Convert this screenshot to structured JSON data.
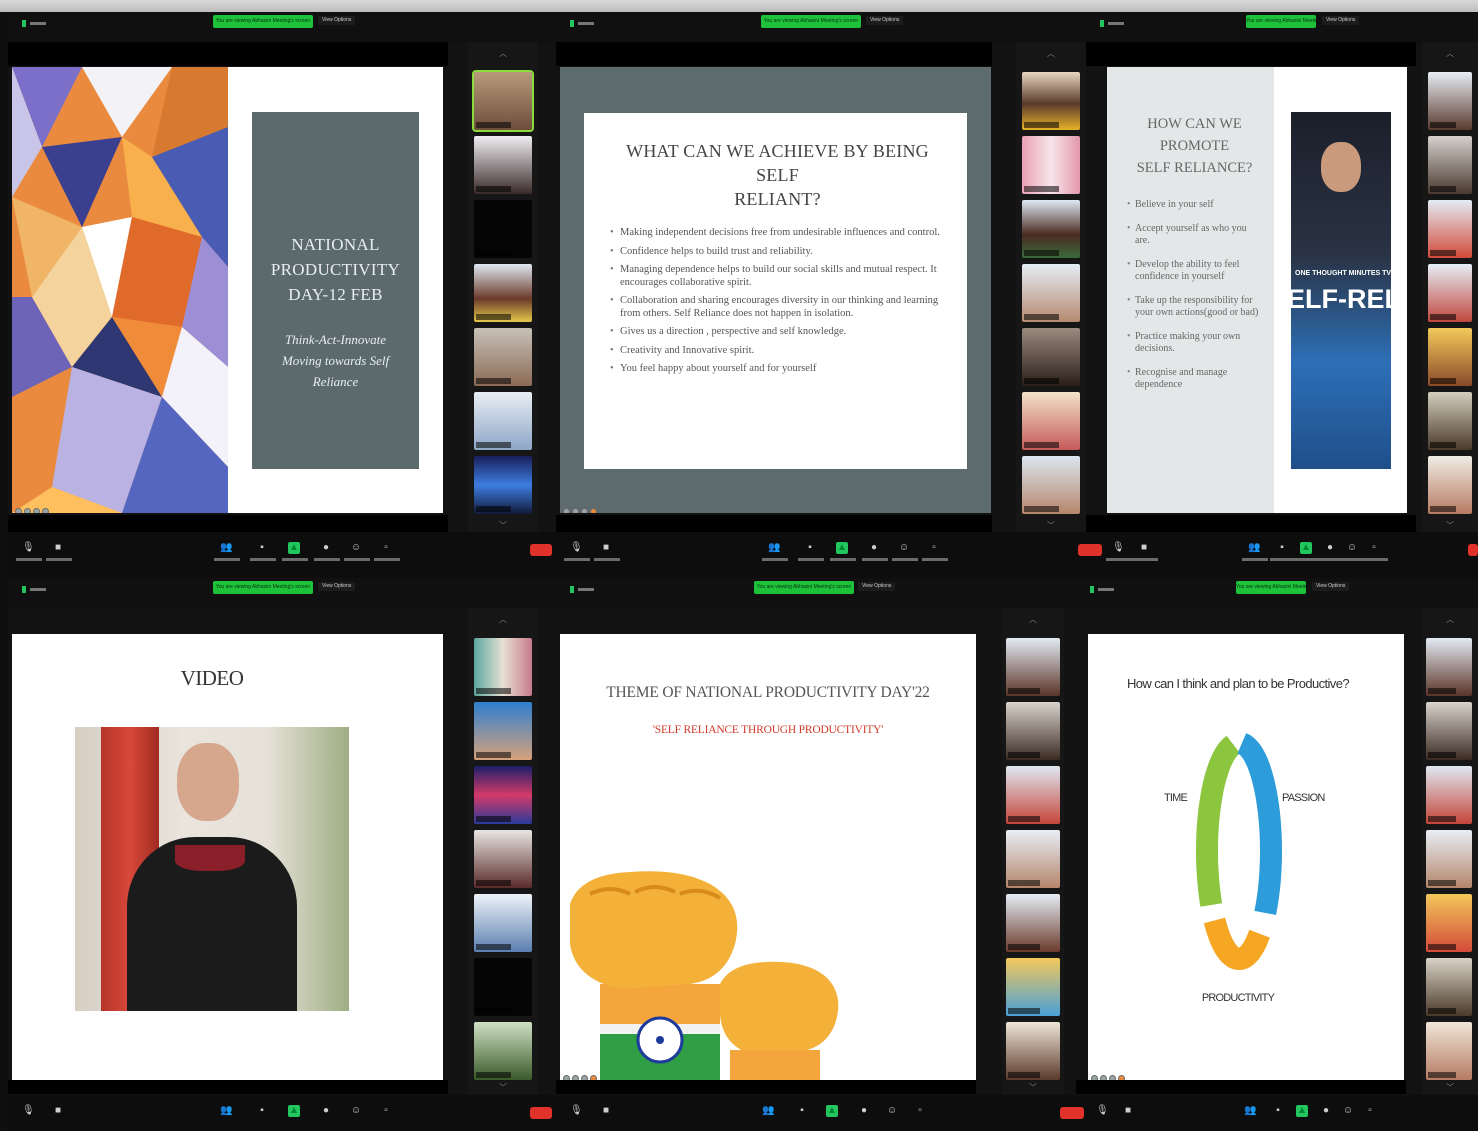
{
  "meetings": [
    {
      "id": "m1",
      "slide": {
        "kind": "title",
        "title_lines": [
          "NATIONAL",
          "PRODUCTIVITY",
          "DAY-12 FEB"
        ],
        "subtitle_lines": [
          "Think-Act-Innovate",
          "Moving towards Self",
          "Reliance"
        ]
      }
    },
    {
      "id": "m2",
      "slide": {
        "kind": "bullets",
        "heading_lines": [
          "WHAT CAN WE ACHIEVE BY BEING SELF",
          "RELIANT?"
        ],
        "bullets": [
          "Making independent decisions free from undesirable influences and control.",
          "Confidence helps to build trust and reliability.",
          "Managing dependence helps to build our social skills and mutual respect. It encourages collaborative spirit.",
          "Collaboration and sharing encourages diversity in our thinking and learning from others. Self Reliance does not happen in isolation.",
          "Gives us a direction , perspective and self knowledge.",
          "Creativity and Innovative spirit.",
          "You feel happy about yourself and for yourself"
        ]
      }
    },
    {
      "id": "m3",
      "slide": {
        "kind": "bullets-photo",
        "heading_lines": [
          "HOW CAN WE PROMOTE",
          "SELF RELIANCE?"
        ],
        "bullets": [
          "Believe in your self",
          "Accept yourself as who you are.",
          "Develop the ability to feel confidence in yourself",
          "Take up the responsibility for your own actions(good or bad)",
          "Practice making your own decisions.",
          "Recognise and manage dependence"
        ],
        "photo_caption_small": "ONE THOUGHT MINUTES TV",
        "photo_caption_big": "ELF-RELIANC"
      }
    },
    {
      "id": "m4",
      "slide": {
        "kind": "video",
        "heading": "VIDEO"
      }
    },
    {
      "id": "m5",
      "slide": {
        "kind": "theme",
        "heading": "THEME OF NATIONAL PRODUCTIVITY DAY'22",
        "subheading": "'SELF RELIANCE THROUGH PRODUCTIVITY'"
      }
    },
    {
      "id": "m6",
      "slide": {
        "kind": "cycle",
        "heading": "How can I think and plan to be Productive?",
        "labels": {
          "left": "TIME",
          "right": "PASSION",
          "bottom": "PRODUCTIVITY"
        },
        "colors": [
          "#8cc63f",
          "#2d9cdb",
          "#f5a623"
        ]
      }
    }
  ],
  "ui": {
    "share_pill": "You are viewing Abhasini Meeting's screen",
    "view_options": "View Options",
    "colors": {
      "share_green": "#1ec23a",
      "end_red": "#e0322b",
      "slide_gray": "#5c6a6c"
    }
  }
}
